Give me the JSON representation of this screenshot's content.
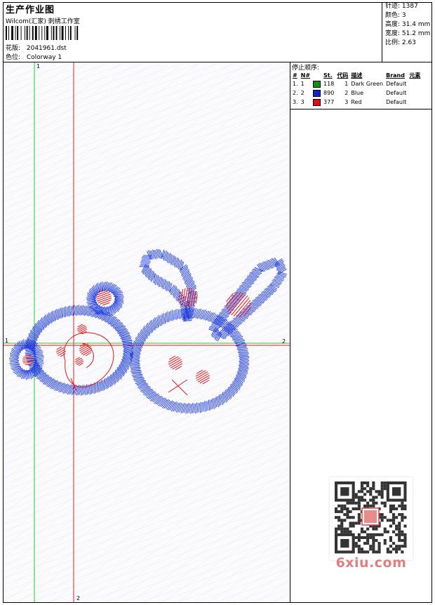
{
  "header": {
    "title": "生产作业图",
    "company": "Wilcom(汇家) 刺绣工作室",
    "design_label": "花版:",
    "design_value": "2041961.dst",
    "colorway_label": "色位:",
    "colorway_value": "Colorway 1"
  },
  "stats": [
    {
      "label": "针迹:",
      "value": "1387"
    },
    {
      "label": "颜色:",
      "value": "3"
    },
    {
      "label": "高度:",
      "value": "31.4 mm"
    },
    {
      "label": "宽度:",
      "value": "51.2 mm"
    },
    {
      "label": "比例:",
      "value": "2.63"
    }
  ],
  "stop_sequence": {
    "title": "停止顺序:",
    "headers": [
      "#",
      "N#",
      "St.",
      "代码",
      "描述",
      "Brand",
      "元素"
    ],
    "rows": [
      {
        "num": "1.",
        "n": "1",
        "color": "#109010",
        "stitches": "118",
        "code": "1",
        "desc": "Dark Green",
        "brand": "Default"
      },
      {
        "num": "2.",
        "n": "2",
        "color": "#1020d8",
        "stitches": "890",
        "code": "2",
        "desc": "Blue",
        "brand": "Default"
      },
      {
        "num": "3.",
        "n": "3",
        "color": "#e01010",
        "stitches": "377",
        "code": "3",
        "desc": "Red",
        "brand": "Default"
      }
    ]
  },
  "guides": {
    "v1_label": "1",
    "v2_label": "2",
    "h1_label": "1",
    "h2_label": "2",
    "v1_color": "#22cc22",
    "v2_color": "#dd2222"
  },
  "thread_colors": {
    "blue": "#1030e0",
    "red": "#e01818"
  },
  "watermark": {
    "text": "6xiu.com",
    "seal": "以图\n图系"
  }
}
